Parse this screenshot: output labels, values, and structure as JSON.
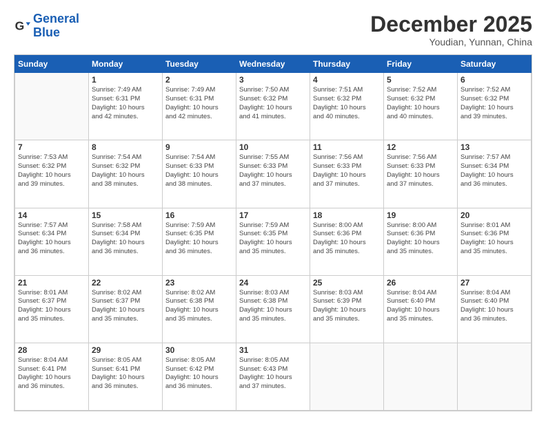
{
  "logo": {
    "line1": "General",
    "line2": "Blue"
  },
  "title": "December 2025",
  "subtitle": "Youdian, Yunnan, China",
  "headers": [
    "Sunday",
    "Monday",
    "Tuesday",
    "Wednesday",
    "Thursday",
    "Friday",
    "Saturday"
  ],
  "weeks": [
    [
      {
        "day": "",
        "info": ""
      },
      {
        "day": "1",
        "info": "Sunrise: 7:49 AM\nSunset: 6:31 PM\nDaylight: 10 hours\nand 42 minutes."
      },
      {
        "day": "2",
        "info": "Sunrise: 7:49 AM\nSunset: 6:31 PM\nDaylight: 10 hours\nand 42 minutes."
      },
      {
        "day": "3",
        "info": "Sunrise: 7:50 AM\nSunset: 6:32 PM\nDaylight: 10 hours\nand 41 minutes."
      },
      {
        "day": "4",
        "info": "Sunrise: 7:51 AM\nSunset: 6:32 PM\nDaylight: 10 hours\nand 40 minutes."
      },
      {
        "day": "5",
        "info": "Sunrise: 7:52 AM\nSunset: 6:32 PM\nDaylight: 10 hours\nand 40 minutes."
      },
      {
        "day": "6",
        "info": "Sunrise: 7:52 AM\nSunset: 6:32 PM\nDaylight: 10 hours\nand 39 minutes."
      }
    ],
    [
      {
        "day": "7",
        "info": "Sunrise: 7:53 AM\nSunset: 6:32 PM\nDaylight: 10 hours\nand 39 minutes."
      },
      {
        "day": "8",
        "info": "Sunrise: 7:54 AM\nSunset: 6:32 PM\nDaylight: 10 hours\nand 38 minutes."
      },
      {
        "day": "9",
        "info": "Sunrise: 7:54 AM\nSunset: 6:33 PM\nDaylight: 10 hours\nand 38 minutes."
      },
      {
        "day": "10",
        "info": "Sunrise: 7:55 AM\nSunset: 6:33 PM\nDaylight: 10 hours\nand 37 minutes."
      },
      {
        "day": "11",
        "info": "Sunrise: 7:56 AM\nSunset: 6:33 PM\nDaylight: 10 hours\nand 37 minutes."
      },
      {
        "day": "12",
        "info": "Sunrise: 7:56 AM\nSunset: 6:33 PM\nDaylight: 10 hours\nand 37 minutes."
      },
      {
        "day": "13",
        "info": "Sunrise: 7:57 AM\nSunset: 6:34 PM\nDaylight: 10 hours\nand 36 minutes."
      }
    ],
    [
      {
        "day": "14",
        "info": "Sunrise: 7:57 AM\nSunset: 6:34 PM\nDaylight: 10 hours\nand 36 minutes."
      },
      {
        "day": "15",
        "info": "Sunrise: 7:58 AM\nSunset: 6:34 PM\nDaylight: 10 hours\nand 36 minutes."
      },
      {
        "day": "16",
        "info": "Sunrise: 7:59 AM\nSunset: 6:35 PM\nDaylight: 10 hours\nand 36 minutes."
      },
      {
        "day": "17",
        "info": "Sunrise: 7:59 AM\nSunset: 6:35 PM\nDaylight: 10 hours\nand 35 minutes."
      },
      {
        "day": "18",
        "info": "Sunrise: 8:00 AM\nSunset: 6:36 PM\nDaylight: 10 hours\nand 35 minutes."
      },
      {
        "day": "19",
        "info": "Sunrise: 8:00 AM\nSunset: 6:36 PM\nDaylight: 10 hours\nand 35 minutes."
      },
      {
        "day": "20",
        "info": "Sunrise: 8:01 AM\nSunset: 6:36 PM\nDaylight: 10 hours\nand 35 minutes."
      }
    ],
    [
      {
        "day": "21",
        "info": "Sunrise: 8:01 AM\nSunset: 6:37 PM\nDaylight: 10 hours\nand 35 minutes."
      },
      {
        "day": "22",
        "info": "Sunrise: 8:02 AM\nSunset: 6:37 PM\nDaylight: 10 hours\nand 35 minutes."
      },
      {
        "day": "23",
        "info": "Sunrise: 8:02 AM\nSunset: 6:38 PM\nDaylight: 10 hours\nand 35 minutes."
      },
      {
        "day": "24",
        "info": "Sunrise: 8:03 AM\nSunset: 6:38 PM\nDaylight: 10 hours\nand 35 minutes."
      },
      {
        "day": "25",
        "info": "Sunrise: 8:03 AM\nSunset: 6:39 PM\nDaylight: 10 hours\nand 35 minutes."
      },
      {
        "day": "26",
        "info": "Sunrise: 8:04 AM\nSunset: 6:40 PM\nDaylight: 10 hours\nand 35 minutes."
      },
      {
        "day": "27",
        "info": "Sunrise: 8:04 AM\nSunset: 6:40 PM\nDaylight: 10 hours\nand 36 minutes."
      }
    ],
    [
      {
        "day": "28",
        "info": "Sunrise: 8:04 AM\nSunset: 6:41 PM\nDaylight: 10 hours\nand 36 minutes."
      },
      {
        "day": "29",
        "info": "Sunrise: 8:05 AM\nSunset: 6:41 PM\nDaylight: 10 hours\nand 36 minutes."
      },
      {
        "day": "30",
        "info": "Sunrise: 8:05 AM\nSunset: 6:42 PM\nDaylight: 10 hours\nand 36 minutes."
      },
      {
        "day": "31",
        "info": "Sunrise: 8:05 AM\nSunset: 6:43 PM\nDaylight: 10 hours\nand 37 minutes."
      },
      {
        "day": "",
        "info": ""
      },
      {
        "day": "",
        "info": ""
      },
      {
        "day": "",
        "info": ""
      }
    ]
  ]
}
